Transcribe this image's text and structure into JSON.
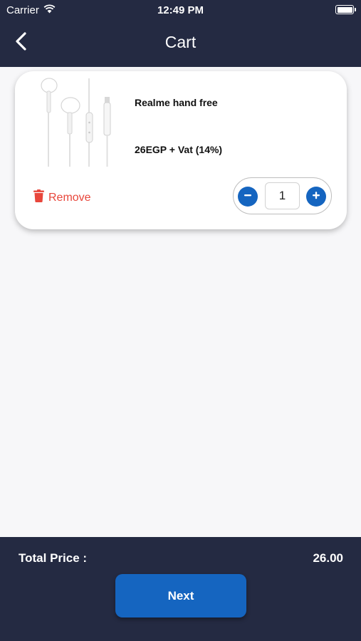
{
  "status_bar": {
    "carrier": "Carrier",
    "time": "12:49 PM",
    "wifi_icon": "wifi-icon",
    "battery_icon": "battery-icon"
  },
  "nav": {
    "title": "Cart",
    "back_icon": "chevron-left-icon"
  },
  "cart": {
    "items": [
      {
        "name": "Realme hand free",
        "price": "26EGP + Vat (14%)",
        "image": "earphones-image",
        "remove_label": "Remove",
        "remove_icon": "trash-icon",
        "quantity": "1",
        "minus_icon": "minus-icon",
        "plus_icon": "plus-icon"
      }
    ]
  },
  "footer": {
    "total_label": "Total Price :",
    "total_value": "26.00",
    "next_label": "Next"
  },
  "colors": {
    "header_bg": "#242a42",
    "accent": "#1565c0",
    "remove": "#e8463b",
    "content_bg": "#f7f7f9"
  }
}
